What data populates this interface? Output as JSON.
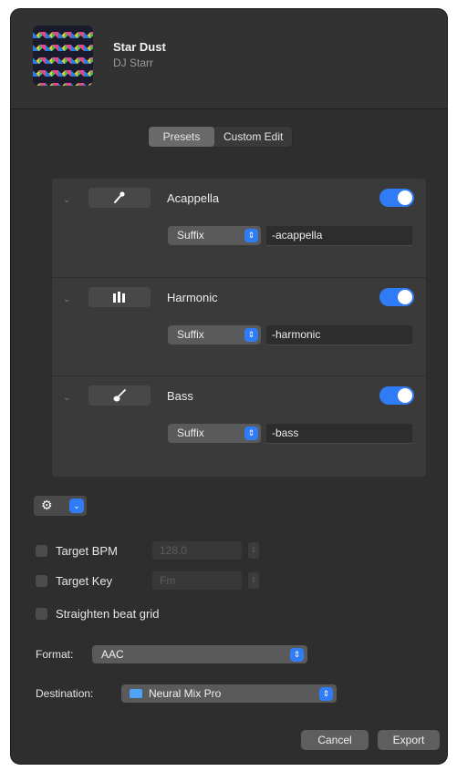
{
  "track": {
    "title": "Star Dust",
    "artist": "DJ Starr"
  },
  "mode_tabs": [
    {
      "label": "Presets",
      "selected": true
    },
    {
      "label": "Custom Edit",
      "selected": false
    }
  ],
  "stems": [
    {
      "name": "Acappella",
      "icon": "microphone-icon",
      "enabled": true,
      "affix_type": "Suffix",
      "affix_value": "-acappella"
    },
    {
      "name": "Harmonic",
      "icon": "piano-keys-icon",
      "enabled": true,
      "affix_type": "Suffix",
      "affix_value": "-harmonic"
    },
    {
      "name": "Bass",
      "icon": "guitar-icon",
      "enabled": true,
      "affix_type": "Suffix",
      "affix_value": "-bass"
    }
  ],
  "options": {
    "target_bpm": {
      "label": "Target BPM",
      "checked": false,
      "value": "128.0"
    },
    "target_key": {
      "label": "Target Key",
      "checked": false,
      "value": "Fm"
    },
    "straighten": {
      "label": "Straighten beat grid",
      "checked": false
    }
  },
  "format": {
    "label": "Format:",
    "value": "AAC"
  },
  "destination": {
    "label": "Destination:",
    "value": "Neural Mix Pro",
    "icon": "folder-icon"
  },
  "buttons": {
    "cancel": "Cancel",
    "export": "Export"
  },
  "colors": {
    "accent": "#2f7cf6",
    "dialog_bg": "#2e2e2e"
  }
}
